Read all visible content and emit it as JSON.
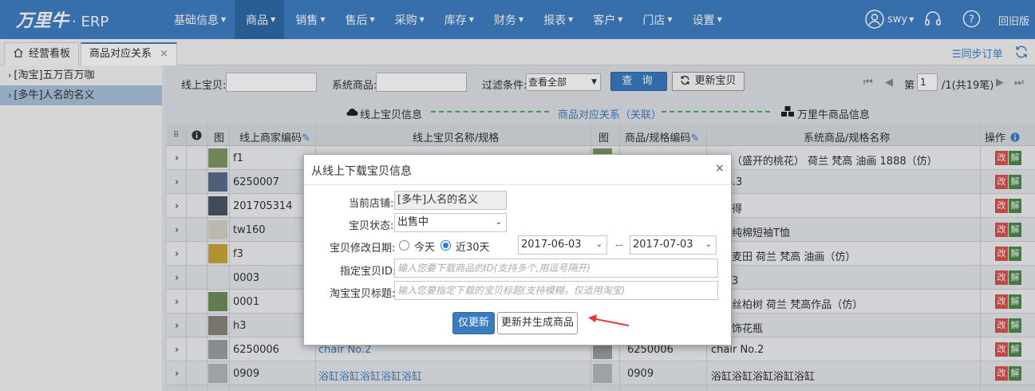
{
  "app": {
    "logo": "万里牛",
    "logo_suffix": "· ERP"
  },
  "nav": {
    "items": [
      {
        "label": "基础信息"
      },
      {
        "label": "商品"
      },
      {
        "label": "销售"
      },
      {
        "label": "售后"
      },
      {
        "label": "采购"
      },
      {
        "label": "库存"
      },
      {
        "label": "财务"
      },
      {
        "label": "报表"
      },
      {
        "label": "客户"
      },
      {
        "label": "门店"
      },
      {
        "label": "设置"
      }
    ],
    "active_index": 1,
    "user": "swy",
    "old_version": "回旧版"
  },
  "tabs": [
    {
      "label": "经营看板"
    },
    {
      "label": "商品对应关系"
    }
  ],
  "tab_close": "×",
  "sync_order": "☰同步订单",
  "shops": [
    {
      "label": "[淘宝]五万百万咖"
    },
    {
      "label": "[多牛]人名的名义"
    }
  ],
  "filter": {
    "online_item_label": "线上宝贝:",
    "system_item_label": "系统商品:",
    "condition_label": "过滤条件:",
    "condition_value": "查看全部",
    "query_button": "查 询",
    "update_button": "更新宝贝"
  },
  "pager": {
    "prefix": "第",
    "page": "1",
    "suffix": "/1(共19笔)"
  },
  "legend": {
    "left": "线上宝贝信息",
    "center": "商品对应关系（关联）",
    "right": "万里牛商品信息"
  },
  "table": {
    "headers": {
      "img": "图",
      "online_code": "线上商家编码",
      "online_name": "线上宝贝名称/规格",
      "img2": "图",
      "sku_code": "商品/规格编码",
      "sys_name": "系统商品/规格名称",
      "ops": "操作"
    },
    "rows": [
      {
        "code": "f1",
        "name": "",
        "sku": "",
        "sys": "花开（盛开的桃花） 荷兰 梵高 油画 1888（仿）",
        "thumb": "#7f9a62"
      },
      {
        "code": "6250007",
        "name": "",
        "sku": "",
        "sys": "r No.3",
        "thumb": "#5a6d8a"
      },
      {
        "code": "201705314",
        "name": "",
        "sku": "",
        "sys": "拍立得",
        "thumb": "#4b5563"
      },
      {
        "code": "tw160",
        "name": "",
        "sku": "",
        "sys": "纯色纯棉短袖T恤",
        "thumb": "#d8d2c6"
      },
      {
        "code": "f3",
        "name": "",
        "sku": "",
        "sys": "下的麦田 荷兰 梵高 油画（仿）",
        "thumb": "#c9a63c"
      },
      {
        "code": "0003",
        "name": "",
        "sku": "",
        "sys": "库存3",
        "thumb": ""
      },
      {
        "code": "0001",
        "name": "",
        "sku": "",
        "sys": "里的丝柏树 荷兰 梵高作品（仿）",
        "thumb": "#6f8f5a"
      },
      {
        "code": "h3",
        "name": "",
        "sku": "",
        "sys": "风装饰花瓶",
        "thumb": "#8c857c"
      },
      {
        "code": "6250006",
        "name": "chair No.2",
        "sku": "6250006",
        "sys": "chair No.2",
        "thumb": "#9aa0a6"
      },
      {
        "code": "0909",
        "name": "浴缸浴缸浴缸浴缸浴缸",
        "sku": "0909",
        "sys": "浴缸浴缸浴缸浴缸浴缸",
        "thumb": "#b4b8bd"
      }
    ],
    "edit_label": "改",
    "unlink_label": "解"
  },
  "dialog": {
    "title": "从线上下载宝贝信息",
    "close": "×",
    "shop_label": "当前店铺:",
    "shop_value": "[多牛]人名的名义",
    "status_label": "宝贝状态:",
    "status_value": "出售中",
    "date_label": "宝贝修改日期:",
    "radio_today": "今天",
    "radio_30": "近30天",
    "date_from": "2017-06-03",
    "date_sep": "--",
    "date_to": "2017-07-03",
    "id_label": "指定宝贝ID:",
    "id_placeholder": "输入您要下载商品的ID(支持多个,用逗号隔开)",
    "title_label": "淘宝宝贝标题:",
    "title_placeholder": "输入您要指定下载的宝贝标题(支持模糊，仅适用淘宝)",
    "update_only": "仅更新",
    "update_generate": "更新并生成商品"
  },
  "colors": {
    "nav": "#3f7fc4",
    "primary_button": "#3a7bc0",
    "edit": "#d9534f",
    "unlink": "#4a8a4a",
    "arrow": "#e53935"
  }
}
